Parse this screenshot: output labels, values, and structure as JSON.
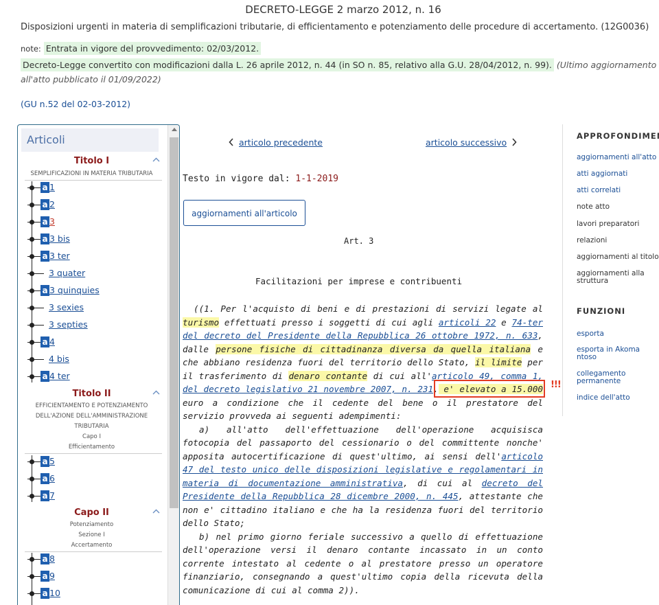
{
  "header": {
    "title": "DECRETO-LEGGE 2 marzo 2012, n. 16",
    "description": "Disposizioni urgenti in materia di semplificazioni tributarie, di efficientamento e potenziamento delle procedure di accertamento. (12G0036)",
    "note_label": "note:",
    "note_entry": "Entrata in vigore del provvedimento: 02/03/2012.",
    "note_conv": "Decreto-Legge convertito con modificazioni dalla L. 26 aprile 2012, n. 44 (in SO n. 85, relativo alla G.U. 28/04/2012, n. 99).",
    "note_agg": "(Ultimo aggiornamento all'atto pubblicato il 01/09/2022)",
    "gu": "(GU n.52 del 02-03-2012)"
  },
  "sidebar": {
    "title": "Articoli",
    "titolo1": "Titolo I",
    "titolo1_sub": "SEMPLIFICAZIONI IN MATERIA TRIBUTARIA",
    "titolo1_items": [
      {
        "label": "1",
        "icon": true
      },
      {
        "label": "2",
        "icon": true
      },
      {
        "label": "3",
        "icon": true,
        "active": true
      },
      {
        "label": "3 bis",
        "icon": true
      },
      {
        "label": "3 ter",
        "icon": true
      },
      {
        "label": "3 quater",
        "icon": false
      },
      {
        "label": "3 quinquies",
        "icon": true
      },
      {
        "label": "3 sexies",
        "icon": false
      },
      {
        "label": "3 septies",
        "icon": false
      },
      {
        "label": "4",
        "icon": true
      },
      {
        "label": "4 bis",
        "icon": false
      },
      {
        "label": "4 ter",
        "icon": true
      }
    ],
    "titolo2": "Titolo II",
    "titolo2_sub1": "EFFICIENTAMENTO E POTENZIAMENTO",
    "titolo2_sub2": "DELL'AZIONE DELL'AMMINISTRAZIONE",
    "titolo2_sub3": "TRIBUTARIA",
    "titolo2_sub4": "Capo I",
    "titolo2_sub5": "Efficientamento",
    "titolo2_items": [
      "5",
      "6",
      "7"
    ],
    "capo2": "Capo II",
    "capo2_sub1": "Potenziamento",
    "capo2_sub2": "Sezione I",
    "capo2_sub3": "Accertamento",
    "capo2_items": [
      "8",
      "9",
      "10"
    ],
    "icon_letter": "a"
  },
  "main": {
    "prev": "articolo precedente",
    "next": "articolo successivo",
    "vigore_label": "Testo in vigore dal:",
    "vigore_date": "1-1-2019",
    "agg_button": "aggiornamenti all'articolo",
    "art_num": "Art. 3",
    "art_title": "Facilitazioni per imprese e contribuenti",
    "warning_marks": "!!!",
    "text": {
      "p1_a": "((1. Per l'acquisto di beni e di prestazioni di servizi  legate  al",
      "p1_turismo": "turismo",
      "p1_b": " effettuati presso i soggetti di cui agli ",
      "p1_link1": "articoli 22",
      "p1_c": " e ",
      "p1_link2": "74-ter del decreto del Presidente della Repubblica 26 ottobre 1972, n.  633",
      "p1_d": ", dalle ",
      "p1_persone": "persone fisiche di cittadinanza diversa da  quella  italiana",
      "p1_e": " e che abbiano residenza fuori del territorio dello Stato, ",
      "p1_limite": "il limite",
      "p1_f": " per il trasferimento di ",
      "p1_denaro": "denaro contante",
      "p1_g": " di cui all'",
      "p1_link3": "articolo 49, comma  1, del decreto legislativo 21 novembre 2007, n. 231",
      "p1_h": ",",
      "p1_elevato": " e' elevato a 15.000",
      "p1_i": " euro a condizione che  il  cedente  del  bene  o  il  prestatore  del servizio provveda ai seguenti adempimenti:",
      "p2_a": "a)  all'atto  dell'effettuazione  dell'operazione  acquisisca fotocopia del passaporto del cessionario o  del  committente  nonche' apposita autocertificazione di quest'ultimo, ai  sensi  dell'",
      "p2_link1": "articolo 47 del testo unico delle disposizioni legislative e regolamentari  in materia di documentazione  amministrativa",
      "p2_b": ",  di  cui  al  ",
      "p2_link2": "decreto  del Presidente della Repubblica 28 dicembre 2000, n. 445",
      "p2_c": ", attestante  che non e' cittadino italiano e che ha la residenza fuori del  territorio dello Stato;",
      "p3": "b) nel primo giorno feriale successivo a quello di  effettuazione dell'operazione versi  il  denaro  contante  incassato  in  un  conto corrente intestato al cedente o al  prestatore  presso  un  operatore finanziario, consegnando a quest'ultimo copia  della  ricevuta  della comunicazione di cui al comma 2))."
    }
  },
  "right": {
    "head1": "APPROFONDIMENTI",
    "items1": [
      {
        "label": "aggiornamenti all'atto",
        "link": true
      },
      {
        "label": "atti aggiornati",
        "link": true
      },
      {
        "label": "atti correlati",
        "link": true
      },
      {
        "label": "note atto",
        "link": false
      },
      {
        "label": "lavori preparatori",
        "link": false
      },
      {
        "label": "relazioni",
        "link": false
      },
      {
        "label": "aggiornamenti al titolo",
        "link": false
      },
      {
        "label": "aggiornamenti alla struttura",
        "link": false
      }
    ],
    "head2": "FUNZIONI",
    "items2": [
      {
        "label": "esporta"
      },
      {
        "label": "esporta in Akoma ntoso"
      },
      {
        "label": "collegamento permanente"
      },
      {
        "label": "indice dell'atto"
      }
    ]
  },
  "colors": {
    "link": "#1a4e95",
    "title_red": "#8b1a1a",
    "highlight_yellow": "#fbf8a8",
    "highlight_green": "#e1f5e1",
    "warn_red": "#e33b22",
    "article_icon": "#1f5faf"
  }
}
